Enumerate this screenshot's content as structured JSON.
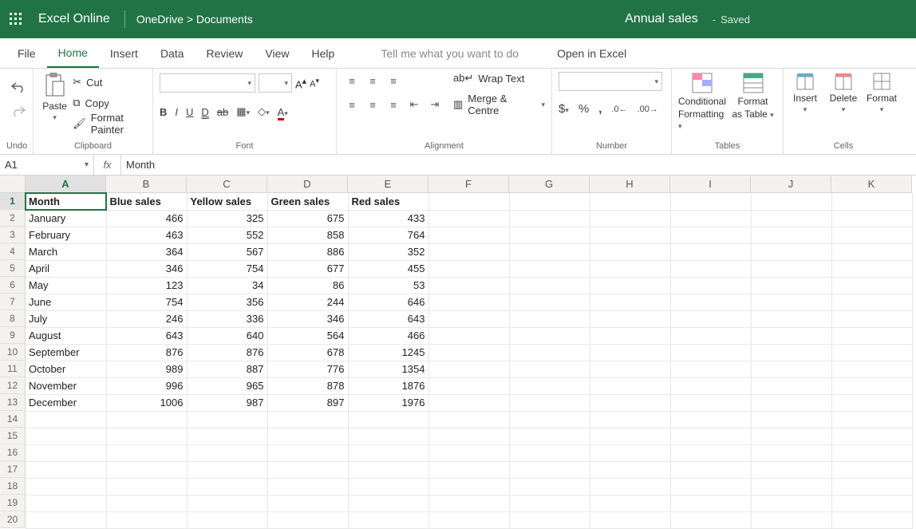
{
  "title": {
    "app": "Excel Online",
    "breadcrumb": "OneDrive > Documents",
    "doc": "Annual sales",
    "status": "Saved"
  },
  "menubar": {
    "file": "File",
    "home": "Home",
    "insert": "Insert",
    "data": "Data",
    "review": "Review",
    "view": "View",
    "help": "Help",
    "tell": "Tell me what you want to do",
    "open": "Open in Excel"
  },
  "ribbon": {
    "undo_label": "Undo",
    "clipboard": {
      "paste": "Paste",
      "cut": "Cut",
      "copy": "Copy",
      "format_painter": "Format Painter",
      "label": "Clipboard"
    },
    "font": {
      "bold": "B",
      "italic": "I",
      "underline": "U",
      "double_u": "D",
      "label": "Font",
      "grow": "A˄",
      "shrink": "A˅"
    },
    "alignment": {
      "wrap": "Wrap Text",
      "merge": "Merge & Centre",
      "label": "Alignment"
    },
    "number": {
      "dollar": "$",
      "percent": "%",
      "comma": ",",
      "inc": "←.0",
      "dec": ".00→",
      "label": "Number"
    },
    "tables": {
      "cond": "Conditional",
      "cond2": "Formatting",
      "tbl": "Format",
      "tbl2": "as Table",
      "label": "Tables"
    },
    "cells": {
      "insert": "Insert",
      "delete": "Delete",
      "format": "Format",
      "label": "Cells"
    }
  },
  "formula": {
    "name": "A1",
    "value": "Month"
  },
  "columns": [
    "A",
    "B",
    "C",
    "D",
    "E",
    "F",
    "G",
    "H",
    "I",
    "J",
    "K"
  ],
  "headers": [
    "Month",
    "Blue sales",
    "Yellow sales",
    "Green sales",
    "Red sales"
  ],
  "rows": [
    [
      "January",
      466,
      325,
      675,
      433
    ],
    [
      "February",
      463,
      552,
      858,
      764
    ],
    [
      "March",
      364,
      567,
      886,
      352
    ],
    [
      "April",
      346,
      754,
      677,
      455
    ],
    [
      "May",
      123,
      34,
      86,
      53
    ],
    [
      "June",
      754,
      356,
      244,
      646
    ],
    [
      "July",
      246,
      336,
      346,
      643
    ],
    [
      "August",
      643,
      640,
      564,
      466
    ],
    [
      "September",
      876,
      876,
      678,
      1245
    ],
    [
      "October",
      989,
      887,
      776,
      1354
    ],
    [
      "November",
      996,
      965,
      878,
      1876
    ],
    [
      "December",
      1006,
      987,
      897,
      1976
    ]
  ],
  "empty_rows": 7,
  "total_cols": 11
}
